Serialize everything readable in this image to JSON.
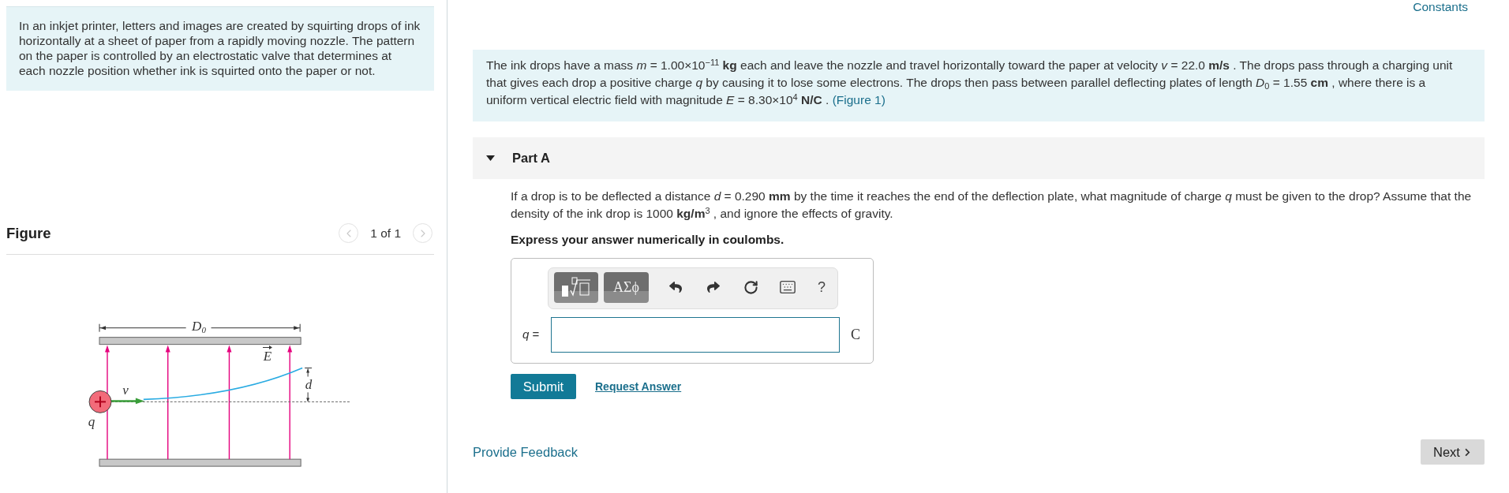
{
  "intro": {
    "text": "In an inkjet printer, letters and images are created by squirting drops of ink horizontally at a sheet of paper from a rapidly moving nozzle. The pattern on the paper is controlled by an electrostatic valve that determines at each nozzle position whether ink is squirted onto the paper or not."
  },
  "figure": {
    "title": "Figure",
    "pager": {
      "text": "1 of 1",
      "prev_disabled": true,
      "next_disabled": true
    },
    "labels": [
      {
        "kind": "length",
        "text": "D$_{0}$"
      },
      {
        "kind": "field",
        "text": "E"
      },
      {
        "kind": "velocity",
        "text": "v"
      },
      {
        "kind": "deflection",
        "text": "d"
      },
      {
        "kind": "charge",
        "text": "q"
      }
    ]
  },
  "constants_link": "Constants",
  "problem": {
    "text": "The ink drops have a mass *m* = 1.00×10$^{−11}$ **kg** each and leave the nozzle and travel horizontally toward the paper at velocity *v* = 22.0 **m/s** . The drops pass through a charging unit that gives each drop a positive charge *q* by causing it to lose some electrons. The drops then pass between parallel deflecting plates of length *D*$_{0}$ = 1.55 **cm** , where there is a uniform vertical electric field with magnitude *E* = 8.30×10$^{4}$ **N/C** .",
    "link": "(Figure 1)"
  },
  "part": {
    "title": "Part A",
    "expanded": true,
    "question": "If a drop is to be deflected a distance *d* = 0.290 **mm** by the time it reaches the end of the deflection plate, what magnitude of charge *q* must be given to the drop? Assume that the density of the ink drop is 1000 **kg/m**$^{3}$ , and ignore the effects of gravity.",
    "instruction": "Express your answer numerically in coulombs.",
    "toolbar": [
      {
        "kind": "templates"
      },
      {
        "kind": "symbols",
        "label": "ΑΣϕ"
      },
      {
        "kind": "undo"
      },
      {
        "kind": "redo"
      },
      {
        "kind": "reset"
      },
      {
        "kind": "keyboard"
      },
      {
        "kind": "help",
        "label": "?"
      }
    ],
    "answer": {
      "variable": "*q* =",
      "unit": "C"
    },
    "submit": "Submit",
    "request": "Request Answer"
  },
  "footer": {
    "feedback": "Provide Feedback",
    "next": "Next"
  }
}
